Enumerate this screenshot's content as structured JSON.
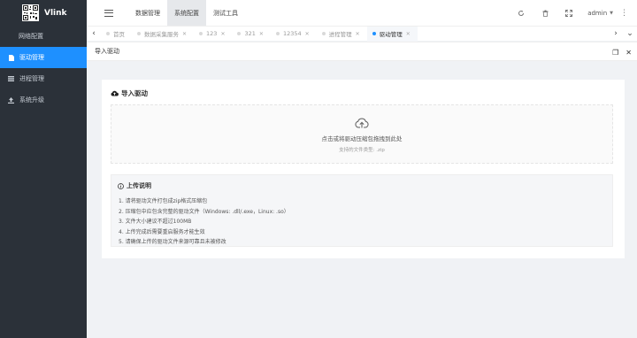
{
  "app": {
    "logo_text": "Vlink"
  },
  "sidebar": {
    "items": [
      {
        "label": "网络配置",
        "type": "sub",
        "active": false,
        "icon": "none"
      },
      {
        "label": "驱动管理",
        "type": "menu",
        "active": true,
        "icon": "file-icon"
      },
      {
        "label": "进程管理",
        "type": "menu",
        "active": false,
        "icon": "list-icon"
      },
      {
        "label": "系统升级",
        "type": "menu",
        "active": false,
        "icon": "upload-icon"
      }
    ]
  },
  "header": {
    "nav": [
      {
        "label": "数据管理",
        "active": false
      },
      {
        "label": "系统配置",
        "active": true
      },
      {
        "label": "测试工具",
        "active": false
      }
    ],
    "user": "admin",
    "icons": [
      "refresh-icon",
      "trash-icon",
      "fullscreen-icon",
      "more-icon"
    ]
  },
  "tabs": [
    {
      "label": "首页",
      "active": false,
      "closable": false
    },
    {
      "label": "数据采集服务",
      "active": false,
      "closable": true
    },
    {
      "label": "123",
      "active": false,
      "closable": true
    },
    {
      "label": "321",
      "active": false,
      "closable": true
    },
    {
      "label": "12354",
      "active": false,
      "closable": true
    },
    {
      "label": "进程管理",
      "active": false,
      "closable": true
    },
    {
      "label": "驱动管理",
      "active": true,
      "closable": true
    }
  ],
  "page": {
    "title": "导入驱动"
  },
  "card": {
    "title": "导入驱动",
    "dropzone": {
      "text": "点击或将驱动压缩包拖拽到此处",
      "sub": "支持的文件类型: .zip"
    },
    "notes": {
      "title": "上传说明",
      "items": [
        "1. 请将驱动文件打包成zip格式压缩包",
        "2. 压缩包中应包含完整的驱动文件（Windows: .dll/.exe，Linux: .so）",
        "3. 文件大小建议不超过100MB",
        "4. 上传完成后需要重启服务才能生效",
        "5. 请确保上传的驱动文件来源可靠且未被修改"
      ]
    }
  },
  "colors": {
    "sidebar_bg": "#2b3139",
    "accent": "#1e90ff"
  }
}
